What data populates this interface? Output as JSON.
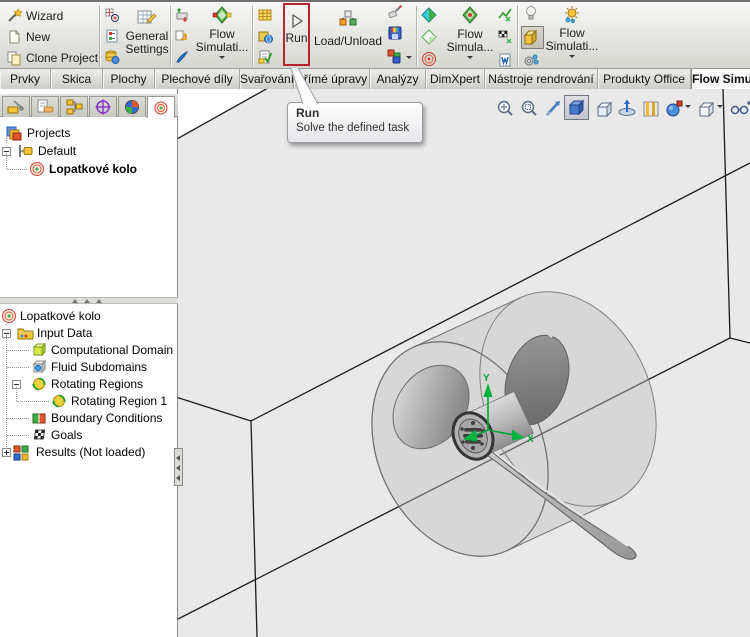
{
  "toolbar": {
    "wizard": "Wizard",
    "new": "New",
    "clone_project": "Clone Project",
    "general_settings": "General\nSettings",
    "flow_simulation_a": "Flow\nSimulati...",
    "run": "Run",
    "load_unload": "Load/Unload",
    "flow_simulation_b": "Flow\nSimula...",
    "flow_simulation_c": "Flow\nSimulati..."
  },
  "tabs": [
    "Prvky",
    "Skica",
    "Plochy",
    "Plechové díly",
    "Svařování",
    "Přímé úpravy",
    "Analýzy",
    "DimXpert",
    "Nástroje rendrování",
    "Produkty Office",
    "Flow Simu..."
  ],
  "tooltip": {
    "title": "Run",
    "description": "Solve the defined task"
  },
  "feature_tree": {
    "items": [
      "Projects",
      "Default",
      "Lopatkové kolo"
    ]
  },
  "sim_tree": {
    "items": [
      "Lopatkové kolo",
      "Input Data",
      "Computational Domain",
      "Fluid Subdomains",
      "Rotating Regions",
      "Rotating Region 1",
      "Boundary Conditions",
      "Goals",
      "Results (Not loaded)"
    ]
  },
  "viewport": {
    "axis_y": "Y",
    "axis_x": "X"
  },
  "colors": {
    "highlight_red": "#b3262a",
    "viewport_bg": "#e9e9e9",
    "triad_green": "#00a33a"
  }
}
